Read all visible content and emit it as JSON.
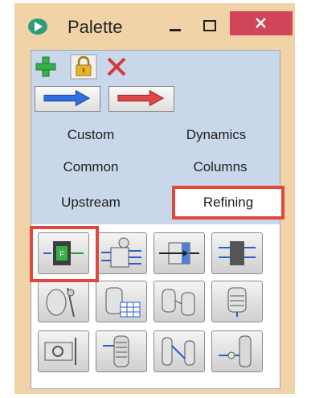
{
  "window": {
    "title": "Palette",
    "controls": {
      "minimize": "minimize",
      "maximize": "maximize",
      "close": "close"
    }
  },
  "toolbar": {
    "icons": [
      "add-icon",
      "lock-icon",
      "delete-icon"
    ],
    "arrow_buttons": [
      "blue-arrow-right",
      "red-arrow-right"
    ]
  },
  "tabs": [
    {
      "label": "Custom"
    },
    {
      "label": "Dynamics"
    },
    {
      "label": "Common"
    },
    {
      "label": "Columns"
    },
    {
      "label": "Upstream"
    },
    {
      "label": "Refining",
      "selected": true
    }
  ],
  "units": [
    "feed-stream-icon",
    "manifold-icon",
    "heat-exchanger-icon",
    "filter-icon",
    "vessel-pump-icon",
    "tank-table-icon",
    "two-tanks-icon",
    "mixer-tank-icon",
    "separator-icon",
    "packed-column-icon",
    "two-column-icon",
    "tall-column-icon"
  ],
  "colors": {
    "highlight": "#e2473c",
    "close_button": "#d0455a",
    "panel_bg": "#c9d7ea",
    "frame_bg": "#f2d3a8"
  }
}
